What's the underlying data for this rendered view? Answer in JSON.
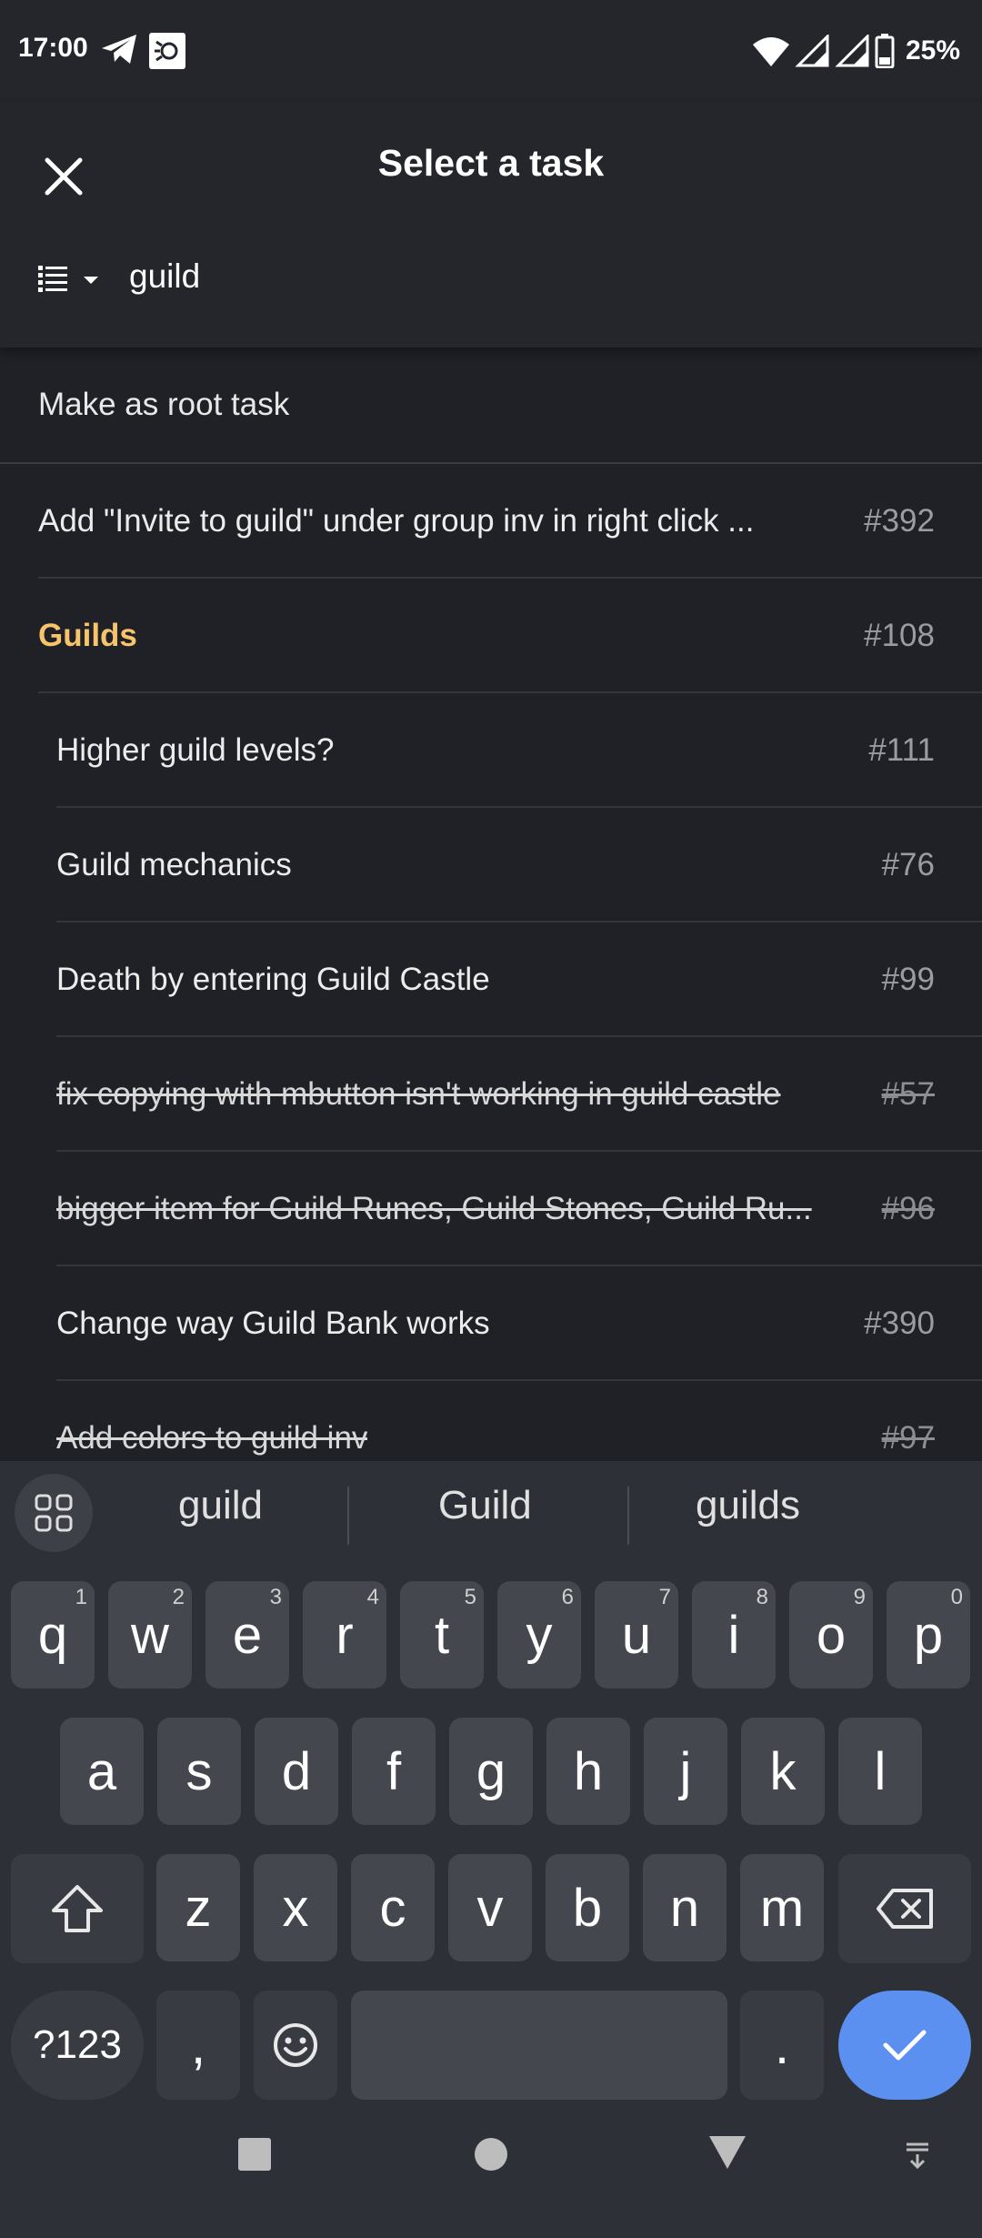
{
  "status_bar": {
    "time": "17:00",
    "battery": "25%",
    "icons": [
      "telegram-icon",
      "app-notification-icon",
      "wifi-icon",
      "signal-5g-icon",
      "signal-3g-icon",
      "battery-icon"
    ]
  },
  "header": {
    "title": "Select a task",
    "close_icon": "close-icon",
    "filter_icon": "list-filter-icon",
    "search_value": "guild"
  },
  "list": {
    "root_label": "Make as root task",
    "rows": [
      {
        "title": "Add \"Invite to guild\" under group inv in right click ...",
        "number": "#392",
        "level": 0,
        "state": "normal"
      },
      {
        "title": "Guilds",
        "number": "#108",
        "level": 0,
        "state": "parent"
      },
      {
        "title": "Higher guild levels?",
        "number": "#111",
        "level": 1,
        "state": "normal"
      },
      {
        "title": "Guild mechanics",
        "number": "#76",
        "level": 1,
        "state": "normal"
      },
      {
        "title": "Death by entering Guild Castle",
        "number": "#99",
        "level": 1,
        "state": "normal"
      },
      {
        "title": "fix copying with mbutton isn't working in guild castle",
        "number": "#57",
        "level": 1,
        "state": "done"
      },
      {
        "title": "bigger item for Guild Runes, Guild Stones, Guild Ru...",
        "number": "#96",
        "level": 1,
        "state": "done"
      },
      {
        "title": "Change way Guild Bank works",
        "number": "#390",
        "level": 1,
        "state": "normal"
      },
      {
        "title": "Add colors to guild inv",
        "number": "#97",
        "level": 1,
        "state": "done"
      }
    ]
  },
  "keyboard": {
    "suggestions": [
      "guild",
      "Guild",
      "guilds"
    ],
    "row1": [
      {
        "k": "q",
        "h": "1"
      },
      {
        "k": "w",
        "h": "2"
      },
      {
        "k": "e",
        "h": "3"
      },
      {
        "k": "r",
        "h": "4"
      },
      {
        "k": "t",
        "h": "5"
      },
      {
        "k": "y",
        "h": "6"
      },
      {
        "k": "u",
        "h": "7"
      },
      {
        "k": "i",
        "h": "8"
      },
      {
        "k": "o",
        "h": "9"
      },
      {
        "k": "p",
        "h": "0"
      }
    ],
    "row2": [
      "a",
      "s",
      "d",
      "f",
      "g",
      "h",
      "j",
      "k",
      "l"
    ],
    "row3": [
      "z",
      "x",
      "c",
      "v",
      "b",
      "n",
      "m"
    ],
    "symbols_label": "?123",
    "comma": ",",
    "period": "."
  },
  "colors": {
    "background": "#202127",
    "header": "#24262c",
    "accent_parent": "#f7c46c",
    "enter_key": "#5b8ff0"
  }
}
